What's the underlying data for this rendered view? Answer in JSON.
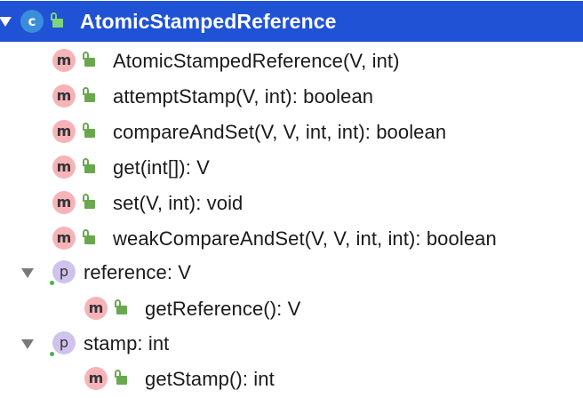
{
  "tree": {
    "class_node": {
      "badge": "c",
      "label": "AtomicStampedReference",
      "expanded": true,
      "icon": "class-icon",
      "selected_color": "#1f52d4"
    },
    "methods": [
      {
        "badge": "m",
        "label": "AtomicStampedReference(V, int)"
      },
      {
        "badge": "m",
        "label": "attemptStamp(V, int): boolean"
      },
      {
        "badge": "m",
        "label": "compareAndSet(V, V, int, int): boolean"
      },
      {
        "badge": "m",
        "label": "get(int[]): V"
      },
      {
        "badge": "m",
        "label": "set(V, int): void"
      },
      {
        "badge": "m",
        "label": "weakCompareAndSet(V, V, int, int): boolean"
      }
    ],
    "properties": [
      {
        "badge": "p",
        "label": "reference: V",
        "expanded": true,
        "children": [
          {
            "badge": "m",
            "label": "getReference(): V"
          }
        ]
      },
      {
        "badge": "p",
        "label": "stamp: int",
        "expanded": true,
        "children": [
          {
            "badge": "m",
            "label": "getStamp(): int"
          }
        ]
      }
    ]
  },
  "icons": {
    "class": "class-icon",
    "method": "method-icon",
    "property": "property-icon",
    "visibility": "public-lock-icon",
    "expand": "expand-arrow-icon"
  },
  "colors": {
    "selection": "#1f52d4",
    "class_badge": "#3b8ddc",
    "method_badge": "#f6b4b8",
    "property_badge": "#cfc3ee",
    "public_lock": "#6aa84f"
  }
}
